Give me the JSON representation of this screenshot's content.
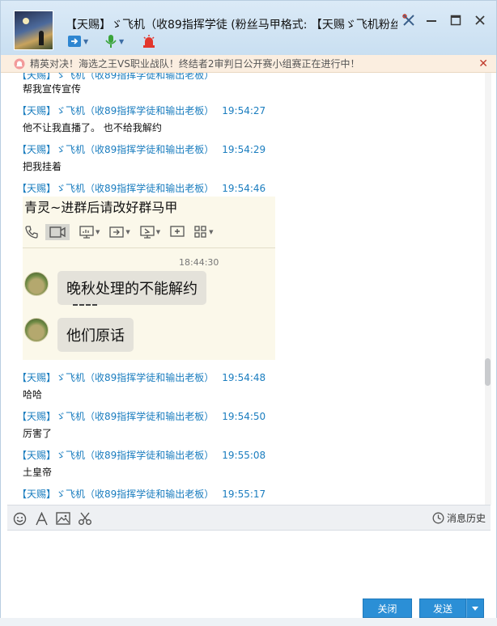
{
  "window": {
    "title": "【天赐】ゞ飞机（收89指挥学徒 (粉丝马甲格式: 【天赐ゞ飞机粉丝"
  },
  "notice": {
    "text": "精英对决！海选之王VS职业战队！终结者2审判日公开赛小组赛正在进行中！"
  },
  "messages": {
    "cut_head": "【天赐】ゞ飞机（收89指挥学徒和输出老板）",
    "cut_body": "帮我宣传宣传",
    "items": [
      {
        "sender": "【天赐】ゞ飞机（收89指挥学徒和输出老板）",
        "time": "19:54:27",
        "text": "他不让我直播了。 也不给我解约"
      },
      {
        "sender": "【天赐】ゞ飞机（收89指挥学徒和输出老板）",
        "time": "19:54:29",
        "text": "把我挂着"
      },
      {
        "sender": "【天赐】ゞ飞机（收89指挥学徒和输出老板）",
        "time": "19:54:46",
        "text": ""
      },
      {
        "sender": "【天赐】ゞ飞机（收89指挥学徒和输出老板）",
        "time": "19:54:48",
        "text": "哈哈"
      },
      {
        "sender": "【天赐】ゞ飞机（收89指挥学徒和输出老板）",
        "time": "19:54:50",
        "text": "厉害了"
      },
      {
        "sender": "【天赐】ゞ飞机（收89指挥学徒和输出老板）",
        "time": "19:55:08",
        "text": "土皇帝"
      },
      {
        "sender": "【天赐】ゞ飞机（收89指挥学徒和输出老板）",
        "time": "19:55:17",
        "text": ""
      }
    ]
  },
  "screenshot": {
    "title": "青灵~进群后请改好群马甲",
    "time": "18:44:30",
    "bubble1": "晚秋处理的不能解约",
    "bubble2": "他们原话"
  },
  "toolbar": {
    "history_label": "消息历史"
  },
  "buttons": {
    "close_label": "关闭",
    "send_label": "发送"
  },
  "colors": {
    "accent": "#2b8fd6",
    "sender_name": "#1a7dbf",
    "notice_bg": "#fbeee0"
  }
}
